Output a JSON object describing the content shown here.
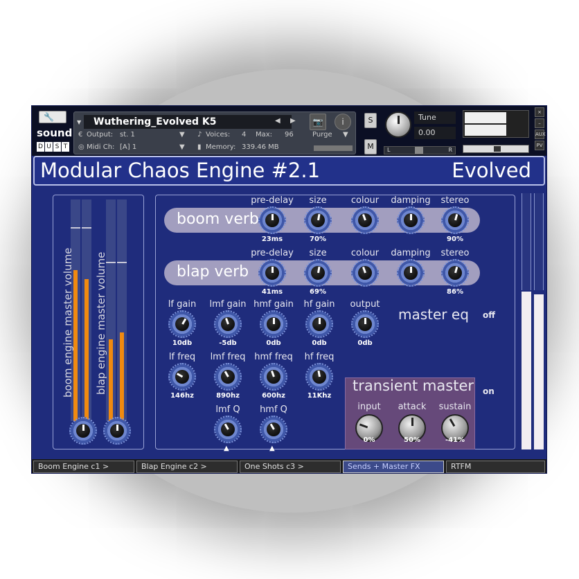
{
  "header": {
    "instrument_name": "Wuthering_Evolved K5",
    "output_label": "Output:",
    "output_value": "st. 1",
    "voices_label": "Voices:",
    "voices_value": "4",
    "max_label": "Max:",
    "max_value": "96",
    "midi_label": "Midi Ch:",
    "midi_value": "[A] 1",
    "memory_label": "Memory:",
    "memory_value": "339.46 MB",
    "purge_label": "Purge",
    "s_label": "S",
    "m_label": "M",
    "tune_label": "Tune",
    "tune_value": "0.00",
    "pan_l": "L",
    "pan_r": "R",
    "aux_label": "AUX",
    "pv_label": "PV",
    "close_label": "×",
    "min_label": "–"
  },
  "logo": {
    "text": "sound",
    "letters": [
      "D",
      "U",
      "S",
      "T"
    ]
  },
  "title": {
    "left": "Modular Chaos Engine #2.1",
    "right": "Evolved"
  },
  "faders": {
    "boom_label": "boom engine master volume",
    "blap_label": "blap engine master volume",
    "boom_level": [
      0.68,
      0.64
    ],
    "blap_level": [
      0.37,
      0.4
    ]
  },
  "boom_verb": {
    "label": "boom verb",
    "params": [
      {
        "name": "pre-delay",
        "value": "23ms"
      },
      {
        "name": "size",
        "value": "70%"
      },
      {
        "name": "colour",
        "value": ""
      },
      {
        "name": "damping",
        "value": ""
      },
      {
        "name": "stereo",
        "value": "90%"
      }
    ]
  },
  "blap_verb": {
    "label": "blap verb",
    "params": [
      {
        "name": "pre-delay",
        "value": "41ms"
      },
      {
        "name": "size",
        "value": "69%"
      },
      {
        "name": "colour",
        "value": ""
      },
      {
        "name": "damping",
        "value": ""
      },
      {
        "name": "stereo",
        "value": "86%"
      }
    ]
  },
  "eq": {
    "title": "master eq",
    "state": "off",
    "gains": [
      {
        "name": "lf gain",
        "value": "10db"
      },
      {
        "name": "lmf gain",
        "value": "-5db"
      },
      {
        "name": "hmf gain",
        "value": "0db"
      },
      {
        "name": "hf gain",
        "value": "0db"
      },
      {
        "name": "output",
        "value": "0db"
      }
    ],
    "freqs": [
      {
        "name": "lf freq",
        "value": "146hz"
      },
      {
        "name": "lmf freq",
        "value": "890hz"
      },
      {
        "name": "hmf freq",
        "value": "600hz"
      },
      {
        "name": "hf freq",
        "value": "11Khz"
      }
    ],
    "q": [
      {
        "name": "lmf Q"
      },
      {
        "name": "hmf Q"
      }
    ]
  },
  "transient": {
    "title": "transient master",
    "state": "on",
    "params": [
      {
        "name": "input",
        "value": "0%"
      },
      {
        "name": "attack",
        "value": "50%"
      },
      {
        "name": "sustain",
        "value": "-41%"
      }
    ]
  },
  "tabs": [
    "Boom Engine c1 >",
    "Blap Engine c2 >",
    "One Shots c3 >",
    "Sends + Master FX",
    "RTFM"
  ],
  "active_tab": 3
}
